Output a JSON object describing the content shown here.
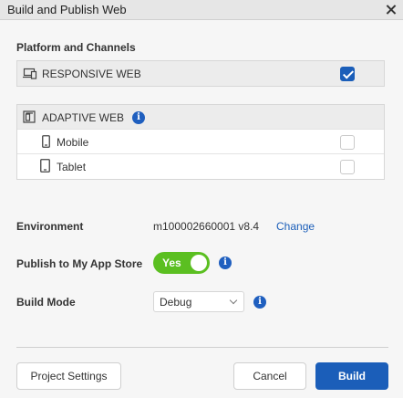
{
  "window": {
    "title": "Build and Publish Web"
  },
  "platform": {
    "section_label": "Platform and Channels",
    "responsive": {
      "label": "RESPONSIVE WEB",
      "checked": true
    },
    "adaptive": {
      "label": "ADAPTIVE WEB",
      "channels": [
        {
          "label": "Mobile",
          "checked": false
        },
        {
          "label": "Tablet",
          "checked": false
        }
      ]
    }
  },
  "environment": {
    "label": "Environment",
    "value": "m100002660001 v8.4",
    "link": "Change"
  },
  "publish": {
    "label": "Publish to My App Store",
    "toggle_text": "Yes",
    "on": true
  },
  "build_mode": {
    "label": "Build Mode",
    "selected": "Debug"
  },
  "footer": {
    "project_settings": "Project Settings",
    "cancel": "Cancel",
    "build": "Build"
  },
  "colors": {
    "accent": "#1b5eb9",
    "toggle_on": "#5bbf21"
  },
  "icons": {
    "responsive": "responsive-web-icon",
    "adaptive": "adaptive-web-icon",
    "mobile": "mobile-icon",
    "tablet": "tablet-icon",
    "info": "info-icon",
    "close": "close-icon"
  }
}
